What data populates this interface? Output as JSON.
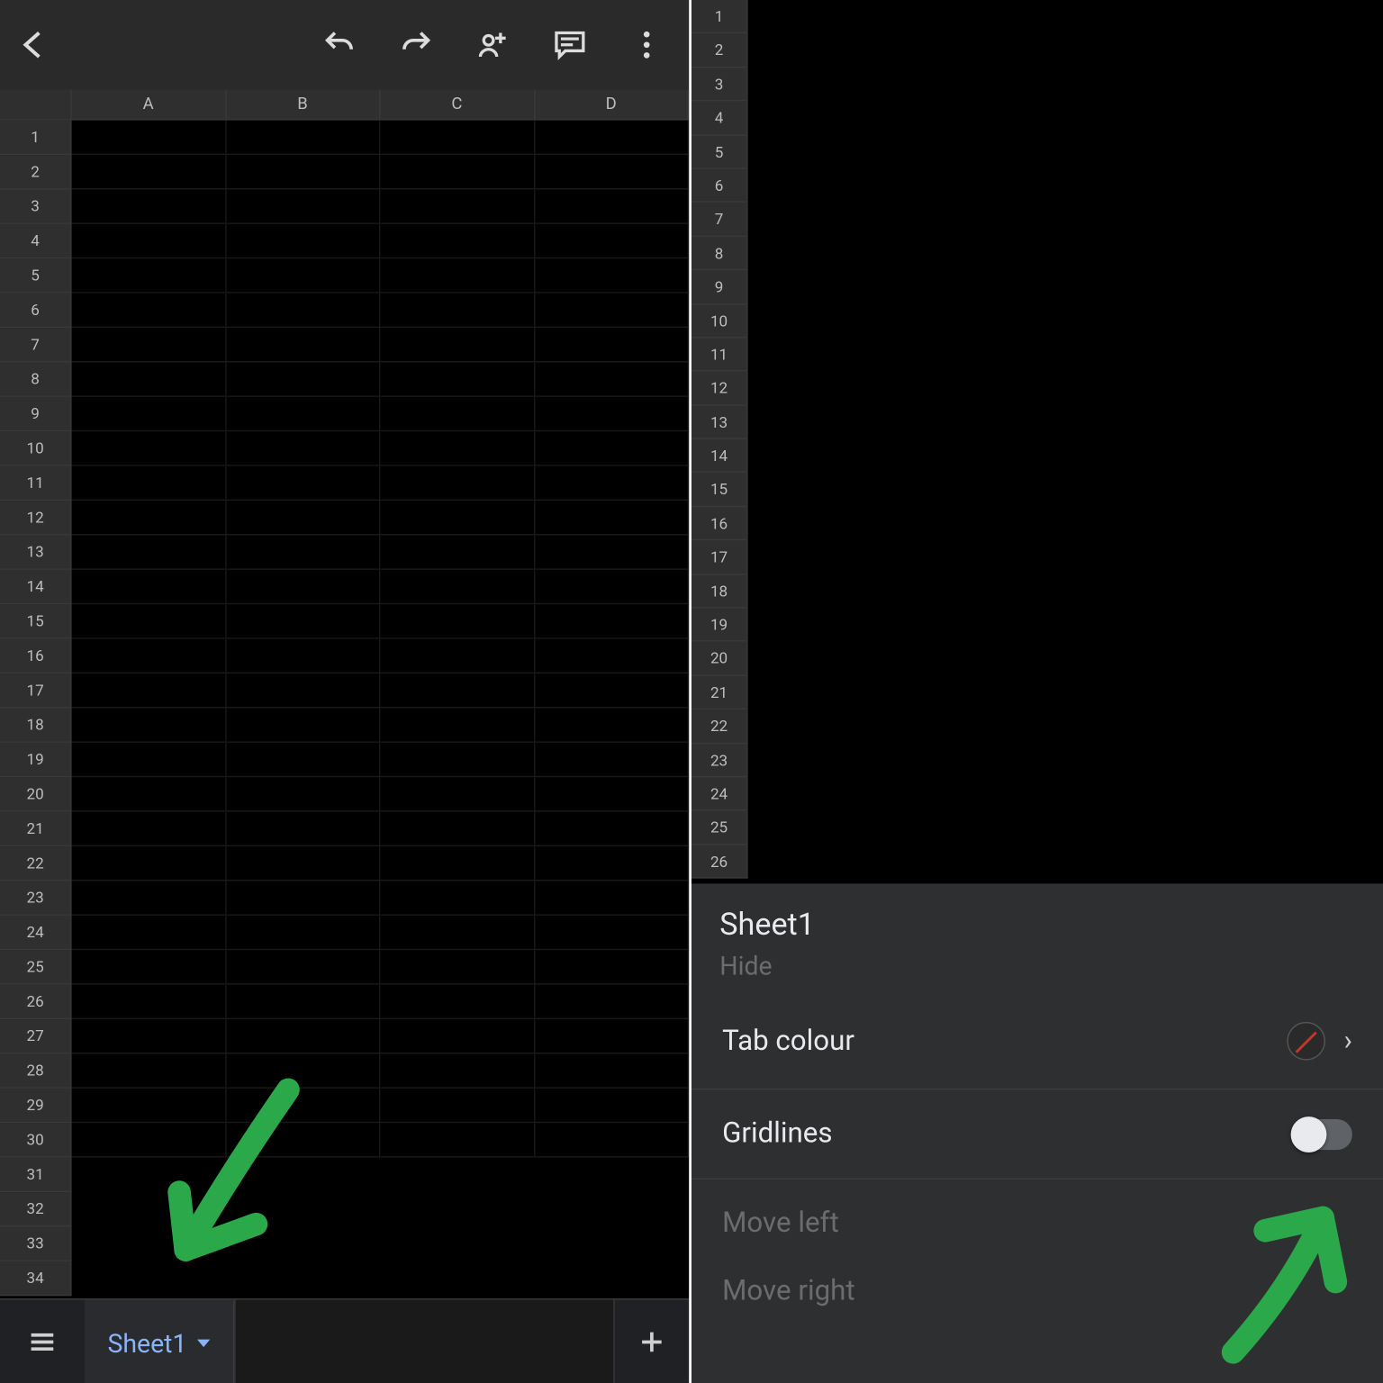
{
  "left": {
    "columns": [
      "A",
      "B",
      "C",
      "D"
    ],
    "row_count": 34,
    "sheet_tab": "Sheet1"
  },
  "right": {
    "row_count": 26,
    "panel": {
      "title": "Sheet1",
      "hide_label": "Hide",
      "tab_colour_label": "Tab colour",
      "gridlines_label": "Gridlines",
      "move_left_label": "Move left",
      "move_right_label": "Move right"
    }
  }
}
